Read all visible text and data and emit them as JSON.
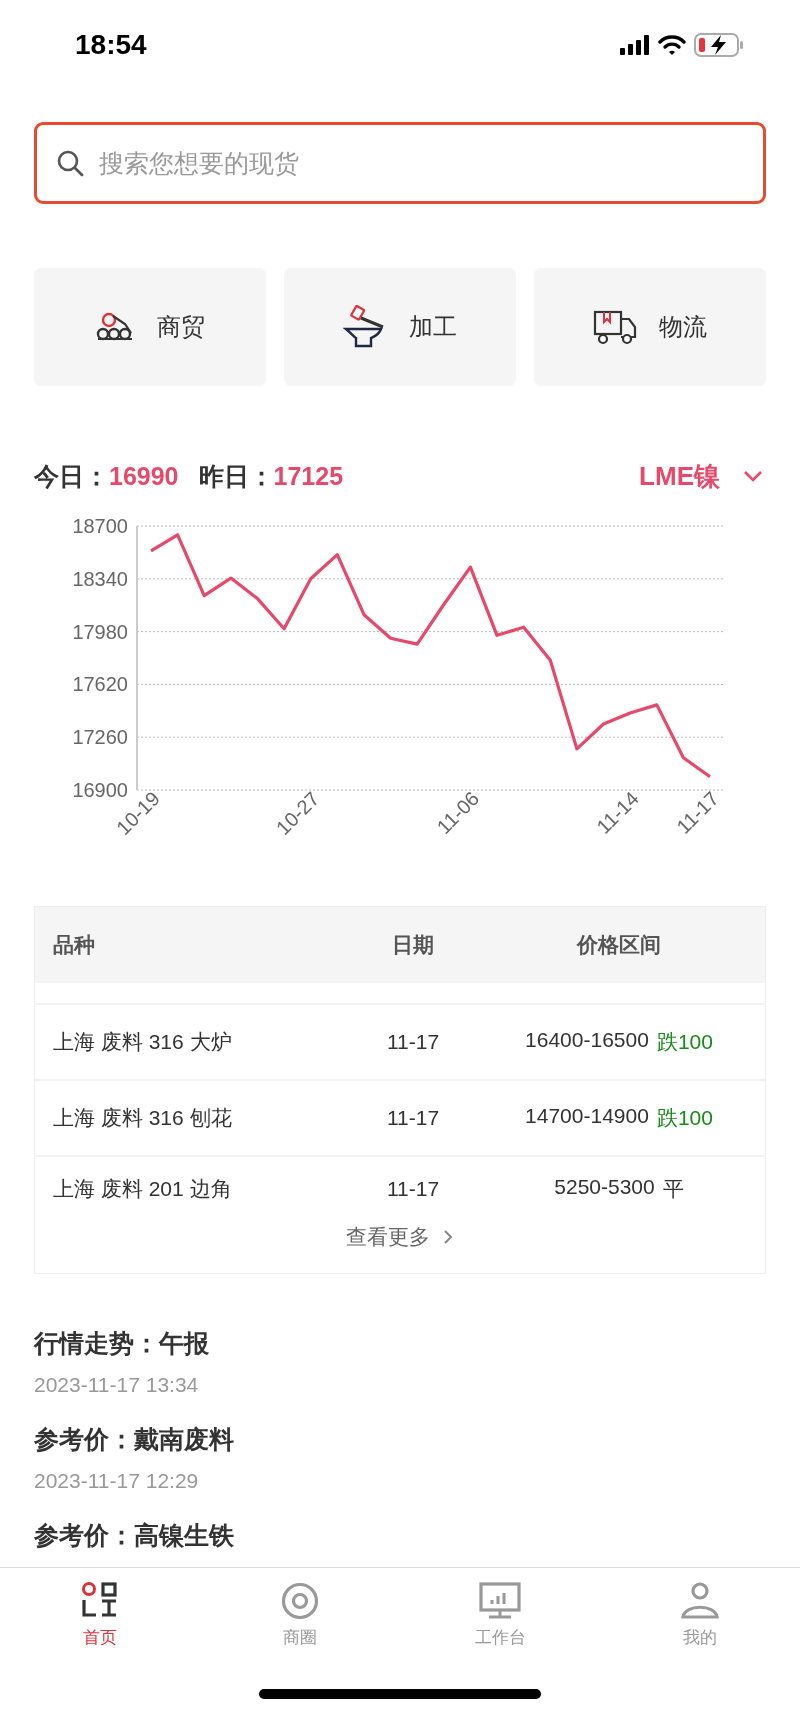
{
  "status_bar": {
    "time": "18:54"
  },
  "search": {
    "placeholder": "搜索您想要的现货"
  },
  "shortcuts": [
    {
      "label": "商贸",
      "kind": "trade"
    },
    {
      "label": "加工",
      "kind": "processing"
    },
    {
      "label": "物流",
      "kind": "logistics"
    }
  ],
  "price_summary": {
    "today_label": "今日：",
    "today_value": "16990",
    "yesterday_label": "昨日：",
    "yesterday_value": "17125",
    "metal_selector": "LME镍"
  },
  "chart": {
    "chart_data": {
      "type": "line",
      "grid": true,
      "categories": [
        "10-19",
        null,
        null,
        null,
        null,
        null,
        "10-27",
        null,
        null,
        null,
        null,
        null,
        "11-06",
        null,
        null,
        null,
        null,
        null,
        "11-14",
        null,
        null,
        "11-17"
      ],
      "ylim": [
        16900,
        18700
      ],
      "yticks": [
        16900,
        17260,
        17620,
        17980,
        18340,
        18700
      ],
      "series": [
        {
          "color": "#e8486a",
          "values": [
            18530,
            18640,
            18225,
            18345,
            18205,
            18000,
            18340,
            18505,
            18095,
            17935,
            17895,
            18165,
            18420,
            17955,
            18010,
            17785,
            17180,
            17350,
            17425,
            17480,
            17120,
            16990
          ]
        }
      ]
    }
  },
  "table": {
    "columns": [
      "品种",
      "日期",
      "价格区间"
    ],
    "rows": [
      {
        "name": "上海 废料 316 大炉",
        "date": "11-17",
        "price": "16400-16500",
        "change": "跌100",
        "kind": "down"
      },
      {
        "name": "上海 废料 316 刨花",
        "date": "11-17",
        "price": "14700-14900",
        "change": "跌100",
        "kind": "down"
      },
      {
        "name": "上海 废料 201 边角",
        "date": "11-17",
        "price": "5250-5300",
        "change": "平",
        "kind": "flat"
      }
    ],
    "more_link": "查看更多"
  },
  "news": [
    {
      "title": "行情走势：午报",
      "time": "2023-11-17 13:34"
    },
    {
      "title": "参考价：戴南废料",
      "time": "2023-11-17 12:29"
    },
    {
      "title": "参考价：高镍生铁"
    }
  ],
  "tab_bar": [
    {
      "label": "首页",
      "kind": "home",
      "selected": true
    },
    {
      "label": "商圈",
      "kind": "circle",
      "selected": false
    },
    {
      "label": "工作台",
      "kind": "workbench",
      "selected": false
    },
    {
      "label": "我的",
      "kind": "profile",
      "selected": false
    }
  ]
}
